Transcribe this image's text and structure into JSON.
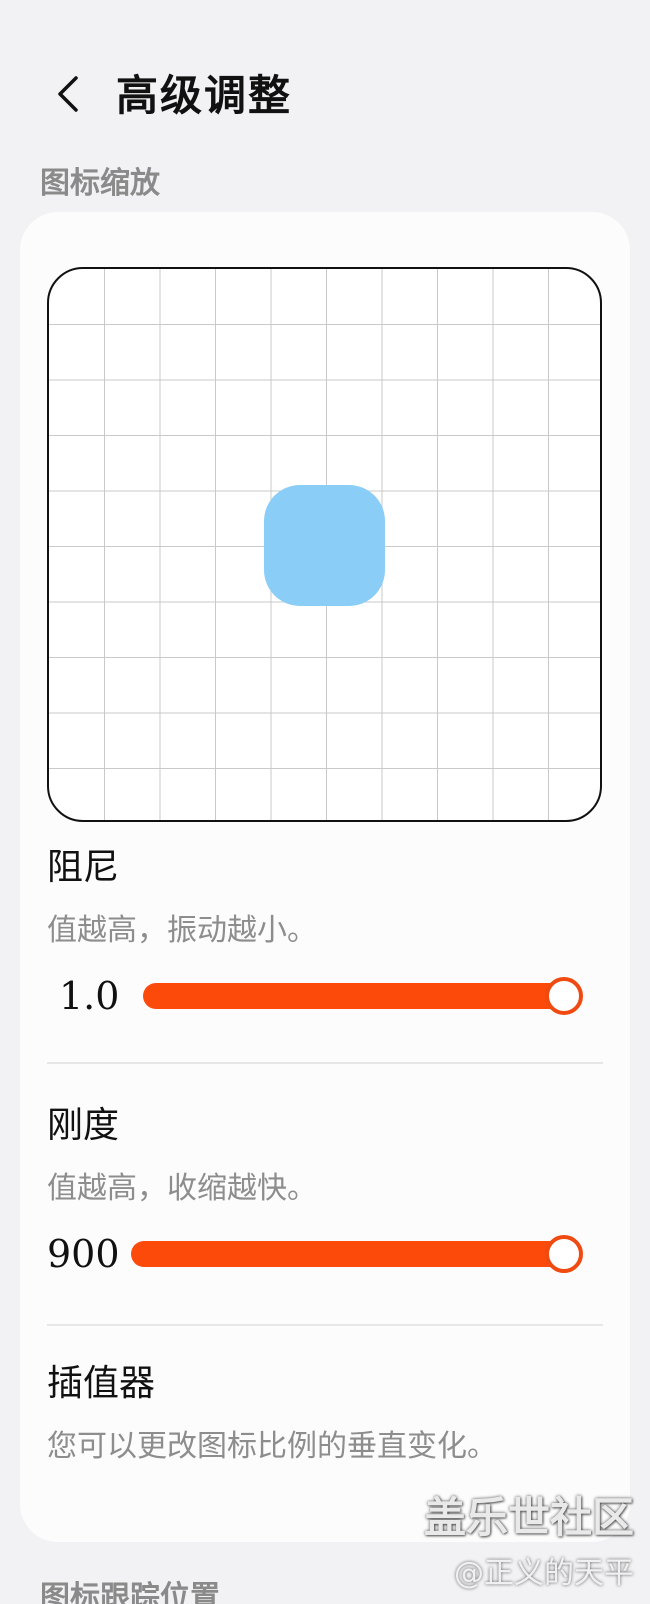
{
  "header": {
    "title": "高级调整",
    "back_icon": "chevron-left-icon"
  },
  "sections": {
    "icon_scale_label": "图标缩放",
    "icon_track_label": "图标跟踪位置"
  },
  "preview": {
    "grid": true,
    "icon_color": "#8acef8"
  },
  "settings": [
    {
      "title": "阻尼",
      "description": "值越高，振动越小。",
      "value": "1.0",
      "fraction": 1.0
    },
    {
      "title": "刚度",
      "description": "值越高，收缩越快。",
      "value": "900",
      "fraction": 1.0
    },
    {
      "title": "插值器",
      "description": "您可以更改图标比例的垂直变化。"
    }
  ],
  "colors": {
    "accent": "#fb4a0a",
    "background": "#f2f2f4",
    "card": "#fcfcfc"
  },
  "watermark": {
    "brand": "盖乐世社区",
    "author": "@正义的天平"
  }
}
